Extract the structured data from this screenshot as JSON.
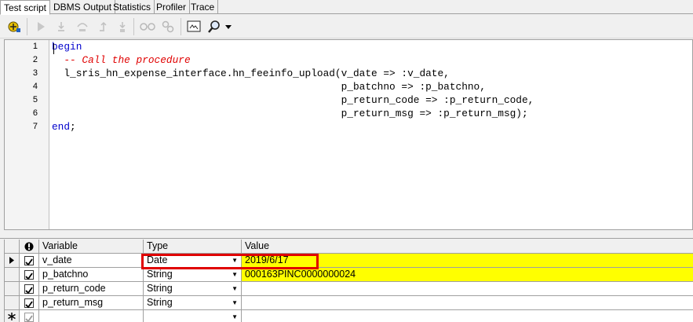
{
  "tabs": [
    "Test script",
    "DBMS Output",
    "Statistics",
    "Profiler",
    "Trace"
  ],
  "toolbar": {
    "icons": [
      "debug-start-icon",
      "run-icon",
      "step-into-icon",
      "step-over-icon",
      "step-out-icon",
      "run-to-exception-icon",
      "toggle-breakpoint-icon",
      "breakpoint-icon",
      "output-window-icon",
      "search-icon",
      "dropdown-arrow-icon"
    ]
  },
  "editor": {
    "line_numbers": [
      "1",
      "2",
      "3",
      "4",
      "5",
      "6",
      "7"
    ],
    "lines": [
      {
        "segments": [
          {
            "text": "begin",
            "kind": "kw"
          }
        ]
      },
      {
        "segments": [
          {
            "text": "  -- Call the procedure",
            "kind": "cm"
          }
        ]
      },
      {
        "segments": [
          {
            "text": "  l_sris_hn_expense_interface.hn_feeinfo_upload(v_date => :v_date,",
            "kind": "plain"
          }
        ]
      },
      {
        "segments": [
          {
            "text": "                                                p_batchno => :p_batchno,",
            "kind": "plain"
          }
        ]
      },
      {
        "segments": [
          {
            "text": "                                                p_return_code => :p_return_code,",
            "kind": "plain"
          }
        ]
      },
      {
        "segments": [
          {
            "text": "                                                p_return_msg => :p_return_msg);",
            "kind": "plain"
          }
        ]
      },
      {
        "segments": [
          {
            "text": "end",
            "kind": "kw"
          },
          {
            "text": ";",
            "kind": "plain"
          }
        ]
      }
    ]
  },
  "grid": {
    "headers": {
      "variable": "Variable",
      "type": "Type",
      "value": "Value"
    },
    "rows": [
      {
        "variable": "v_date",
        "type": "Date",
        "value": "2019/6/17",
        "checked": true,
        "current": true,
        "yellow": true
      },
      {
        "variable": "p_batchno",
        "type": "String",
        "value": "000163PINC0000000024",
        "checked": true,
        "current": false,
        "yellow": true
      },
      {
        "variable": "p_return_code",
        "type": "String",
        "value": "",
        "checked": true,
        "current": false,
        "yellow": false
      },
      {
        "variable": "p_return_msg",
        "type": "String",
        "value": "",
        "checked": true,
        "current": false,
        "yellow": false
      },
      {
        "variable": "",
        "type": "",
        "value": "",
        "checked": true,
        "current": false,
        "yellow": false,
        "new_row": true
      }
    ]
  },
  "colors": {
    "keyword": "#0000cc",
    "comment": "#e00000",
    "value_highlight": "#ffff00",
    "annotation_box": "#e00000"
  }
}
